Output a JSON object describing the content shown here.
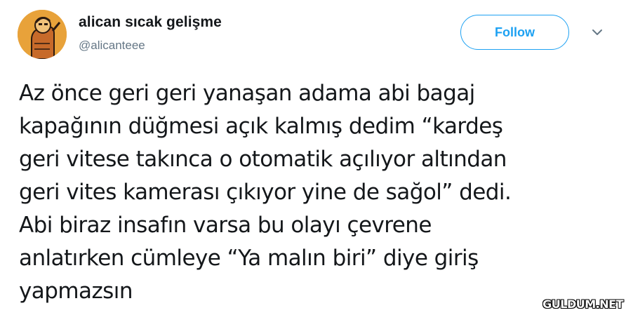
{
  "author": {
    "display_name": "alican sıcak gelişme",
    "handle": "@alicanteee"
  },
  "header": {
    "follow_label": "Follow",
    "menu_icon": "chevron-down-icon"
  },
  "tweet": {
    "text": "Az önce geri geri yanaşan adama abi bagaj\nkapağının düğmesi açık kalmış dedim “kardeş\ngeri vitese takınca o otomatik açılıyor altından\ngeri vites kamerası çıkıyor yine de sağol” dedi.\nAbi biraz insafın varsa bu olayı çevrene\nanlatırken cümleye “Ya malın biri” diye giriş\nyapmazsın"
  },
  "watermark": {
    "text": "GULDUM.NET"
  },
  "colors": {
    "accent": "#1da1f2",
    "text": "#14171a",
    "secondary": "#657786",
    "avatar_bg": "#e8a23a"
  }
}
